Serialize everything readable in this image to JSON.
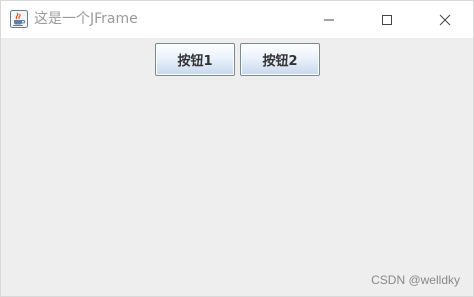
{
  "window": {
    "title": "这是一个JFrame",
    "icon": "java-coffee-cup-icon",
    "controls": {
      "minimize_icon": "minimize-icon",
      "maximize_icon": "maximize-icon",
      "close_icon": "close-icon"
    }
  },
  "content": {
    "buttons": [
      {
        "label": "按钮1"
      },
      {
        "label": "按钮2"
      }
    ]
  },
  "watermark": "CSDN @welldky",
  "colors": {
    "background": "#eeeeee",
    "titlebar": "#ffffff",
    "title_text": "#9a9a9a",
    "button_border": "#7a8a99",
    "button_gradient_bottom": "#c7d8ec"
  }
}
